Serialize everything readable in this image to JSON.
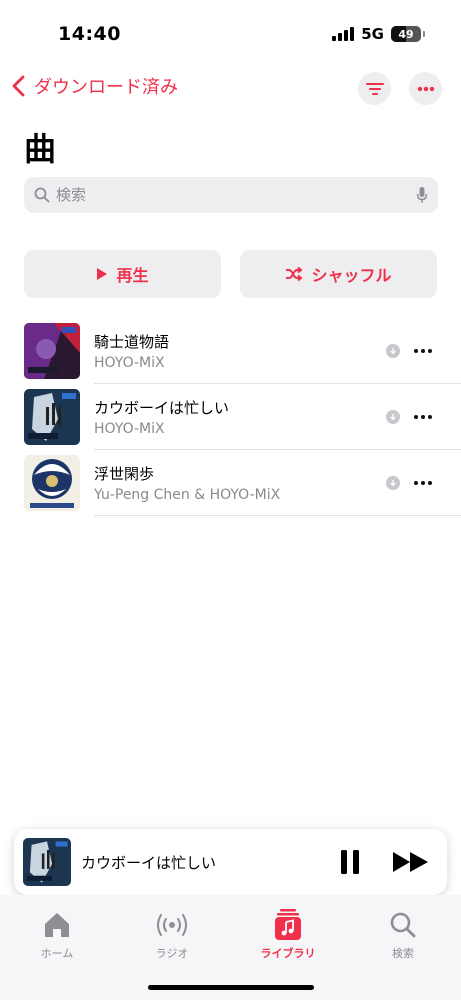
{
  "status_bar": {
    "time": "14:40",
    "network": "5G",
    "battery_level": "49"
  },
  "nav": {
    "back_label": "ダウンロード済み",
    "filter_icon": "filter-icon",
    "more_icon": "ellipsis-icon"
  },
  "page": {
    "title": "曲"
  },
  "search": {
    "placeholder": "検索"
  },
  "actions": {
    "play_label": "再生",
    "shuffle_label": "シャッフル"
  },
  "songs": [
    {
      "title": "騎士道物語",
      "artist": "HOYO-MiX"
    },
    {
      "title": "カウボーイは忙しい",
      "artist": "HOYO-MiX"
    },
    {
      "title": "浮世閑歩",
      "artist": "Yu-Peng Chen & HOYO-MiX"
    }
  ],
  "now_playing": {
    "title": "カウボーイは忙しい"
  },
  "tabs": [
    {
      "label": "ホーム",
      "icon": "home-icon"
    },
    {
      "label": "ラジオ",
      "icon": "radio-icon"
    },
    {
      "label": "ライブラリ",
      "icon": "library-icon"
    },
    {
      "label": "検索",
      "icon": "search-icon"
    }
  ],
  "colors": {
    "accent": "#f0304a",
    "secondary_text": "#8a8a8e",
    "button_bg": "#eeeef0"
  }
}
